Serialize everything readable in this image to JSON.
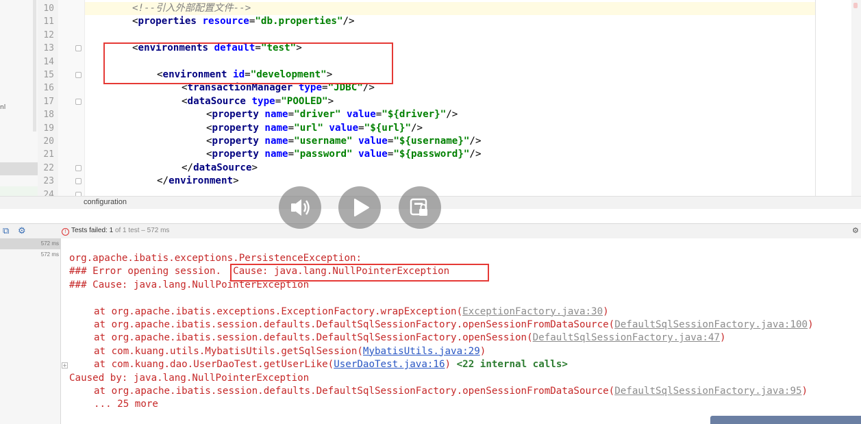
{
  "editor": {
    "lines": [
      {
        "num": "10",
        "indent": 1,
        "parts": [
          {
            "t": "<!--引入外部配置文件-->",
            "c": "comment"
          }
        ]
      },
      {
        "num": "11",
        "indent": 1,
        "parts": [
          {
            "t": "<",
            "c": "punct"
          },
          {
            "t": "properties",
            "c": "tag"
          },
          {
            "t": " resource",
            "c": "attr"
          },
          {
            "t": "=",
            "c": "punct"
          },
          {
            "t": "\"db.properties\"",
            "c": "val"
          },
          {
            "t": "/>",
            "c": "punct"
          }
        ]
      },
      {
        "num": "12",
        "indent": 0,
        "parts": []
      },
      {
        "num": "13",
        "indent": 1,
        "parts": [
          {
            "t": "<",
            "c": "punct"
          },
          {
            "t": "environments",
            "c": "tag"
          },
          {
            "t": " default",
            "c": "attr"
          },
          {
            "t": "=",
            "c": "punct"
          },
          {
            "t": "\"test\"",
            "c": "val"
          },
          {
            "t": ">",
            "c": "punct"
          }
        ]
      },
      {
        "num": "14",
        "indent": 0,
        "parts": []
      },
      {
        "num": "15",
        "indent": 2,
        "parts": [
          {
            "t": "<",
            "c": "punct"
          },
          {
            "t": "environment",
            "c": "tag"
          },
          {
            "t": " id",
            "c": "attr"
          },
          {
            "t": "=",
            "c": "punct"
          },
          {
            "t": "\"development\"",
            "c": "val"
          },
          {
            "t": ">",
            "c": "punct"
          }
        ]
      },
      {
        "num": "16",
        "indent": 3,
        "parts": [
          {
            "t": "<",
            "c": "punct"
          },
          {
            "t": "transactionManager",
            "c": "tag"
          },
          {
            "t": " type",
            "c": "attr"
          },
          {
            "t": "=",
            "c": "punct"
          },
          {
            "t": "\"JDBC\"",
            "c": "val"
          },
          {
            "t": "/>",
            "c": "punct"
          }
        ]
      },
      {
        "num": "17",
        "indent": 3,
        "parts": [
          {
            "t": "<",
            "c": "punct"
          },
          {
            "t": "dataSource",
            "c": "tag"
          },
          {
            "t": " type",
            "c": "attr"
          },
          {
            "t": "=",
            "c": "punct"
          },
          {
            "t": "\"POOLED\"",
            "c": "val"
          },
          {
            "t": ">",
            "c": "punct"
          }
        ]
      },
      {
        "num": "18",
        "indent": 4,
        "parts": [
          {
            "t": "<",
            "c": "punct"
          },
          {
            "t": "property",
            "c": "tag"
          },
          {
            "t": " name",
            "c": "attr"
          },
          {
            "t": "=",
            "c": "punct"
          },
          {
            "t": "\"driver\"",
            "c": "val"
          },
          {
            "t": " value",
            "c": "attr"
          },
          {
            "t": "=",
            "c": "punct"
          },
          {
            "t": "\"${driver}\"",
            "c": "val"
          },
          {
            "t": "/>",
            "c": "punct"
          }
        ]
      },
      {
        "num": "19",
        "indent": 4,
        "parts": [
          {
            "t": "<",
            "c": "punct"
          },
          {
            "t": "property",
            "c": "tag"
          },
          {
            "t": " name",
            "c": "attr"
          },
          {
            "t": "=",
            "c": "punct"
          },
          {
            "t": "\"url\"",
            "c": "val"
          },
          {
            "t": " value",
            "c": "attr"
          },
          {
            "t": "=",
            "c": "punct"
          },
          {
            "t": "\"${url}\"",
            "c": "val"
          },
          {
            "t": "/>",
            "c": "punct"
          }
        ]
      },
      {
        "num": "20",
        "indent": 4,
        "parts": [
          {
            "t": "<",
            "c": "punct"
          },
          {
            "t": "property",
            "c": "tag"
          },
          {
            "t": " name",
            "c": "attr"
          },
          {
            "t": "=",
            "c": "punct"
          },
          {
            "t": "\"username\"",
            "c": "val"
          },
          {
            "t": " value",
            "c": "attr"
          },
          {
            "t": "=",
            "c": "punct"
          },
          {
            "t": "\"${username}\"",
            "c": "val"
          },
          {
            "t": "/>",
            "c": "punct"
          }
        ]
      },
      {
        "num": "21",
        "indent": 4,
        "parts": [
          {
            "t": "<",
            "c": "punct"
          },
          {
            "t": "property",
            "c": "tag"
          },
          {
            "t": " name",
            "c": "attr"
          },
          {
            "t": "=",
            "c": "punct"
          },
          {
            "t": "\"password\"",
            "c": "val"
          },
          {
            "t": " value",
            "c": "attr"
          },
          {
            "t": "=",
            "c": "punct"
          },
          {
            "t": "\"${password}\"",
            "c": "val"
          },
          {
            "t": "/>",
            "c": "punct"
          }
        ]
      },
      {
        "num": "22",
        "indent": 3,
        "parts": [
          {
            "t": "</",
            "c": "punct"
          },
          {
            "t": "dataSource",
            "c": "tag"
          },
          {
            "t": ">",
            "c": "punct"
          }
        ]
      },
      {
        "num": "23",
        "indent": 2,
        "parts": [
          {
            "t": "</",
            "c": "punct"
          },
          {
            "t": "environment",
            "c": "tag"
          },
          {
            "t": ">",
            "c": "punct"
          }
        ]
      },
      {
        "num": "24",
        "indent": 0,
        "parts": []
      }
    ],
    "breadcrumb": "configuration",
    "left_panel_char": "nl"
  },
  "run_panel": {
    "status_failed": "Tests failed:",
    "status_count": "1",
    "status_rest": "of 1 test – 572 ms",
    "times": [
      "572 ms",
      "572 ms"
    ],
    "console_lines": [
      {
        "indent": 0,
        "parts": [
          {
            "t": "org.apache.ibatis.exceptions.PersistenceException:",
            "c": "txt"
          }
        ]
      },
      {
        "indent": 0,
        "parts": [
          {
            "t": "### Error opening session.  Cause: java.lang.NullPointerException",
            "c": "txt"
          }
        ]
      },
      {
        "indent": 0,
        "parts": [
          {
            "t": "### Cause: java.lang.NullPointerException",
            "c": "txt"
          }
        ]
      },
      {
        "indent": 0,
        "parts": []
      },
      {
        "indent": 1,
        "parts": [
          {
            "t": "at org.apache.ibatis.exceptions.ExceptionFactory.wrapException(",
            "c": "txt"
          },
          {
            "t": "ExceptionFactory.java:30",
            "c": "link-gray"
          },
          {
            "t": ")",
            "c": "txt"
          }
        ]
      },
      {
        "indent": 1,
        "parts": [
          {
            "t": "at org.apache.ibatis.session.defaults.DefaultSqlSessionFactory.openSessionFromDataSource(",
            "c": "txt"
          },
          {
            "t": "DefaultSqlSessionFactory.java:100",
            "c": "link-gray"
          },
          {
            "t": ")",
            "c": "txt"
          }
        ]
      },
      {
        "indent": 1,
        "parts": [
          {
            "t": "at org.apache.ibatis.session.defaults.DefaultSqlSessionFactory.openSession(",
            "c": "txt"
          },
          {
            "t": "DefaultSqlSessionFactory.java:47",
            "c": "link-gray"
          },
          {
            "t": ")",
            "c": "txt"
          }
        ]
      },
      {
        "indent": 1,
        "parts": [
          {
            "t": "at com.kuang.utils.MybatisUtils.getSqlSession(",
            "c": "txt"
          },
          {
            "t": "MybatisUtils.java:29",
            "c": "link"
          },
          {
            "t": ")",
            "c": "txt"
          }
        ]
      },
      {
        "indent": 1,
        "parts": [
          {
            "t": "at com.kuang.dao.UserDaoTest.getUserLike(",
            "c": "txt"
          },
          {
            "t": "UserDaoTest.java:16",
            "c": "link"
          },
          {
            "t": ") ",
            "c": "txt"
          },
          {
            "t": "<22 internal calls>",
            "c": "internal"
          }
        ]
      },
      {
        "indent": 0,
        "parts": [
          {
            "t": "Caused by: java.lang.NullPointerException",
            "c": "txt"
          }
        ]
      },
      {
        "indent": 1,
        "parts": [
          {
            "t": "at org.apache.ibatis.session.defaults.DefaultSqlSessionFactory.openSessionFromDataSource(",
            "c": "txt"
          },
          {
            "t": "DefaultSqlSessionFactory.java:95",
            "c": "link-gray"
          },
          {
            "t": ")",
            "c": "txt"
          }
        ]
      },
      {
        "indent": 1,
        "parts": [
          {
            "t": "... 25 more",
            "c": "txt"
          }
        ]
      }
    ]
  },
  "overlay": {
    "buttons": [
      "volume-icon",
      "play-icon",
      "caption-lock-icon"
    ]
  },
  "colors": {
    "highlight_box": "#e53935",
    "tag": "#000080",
    "attribute": "#0000ff",
    "value": "#008000",
    "comment": "#808080",
    "console_error": "#c62828",
    "link": "#2a57c4"
  }
}
